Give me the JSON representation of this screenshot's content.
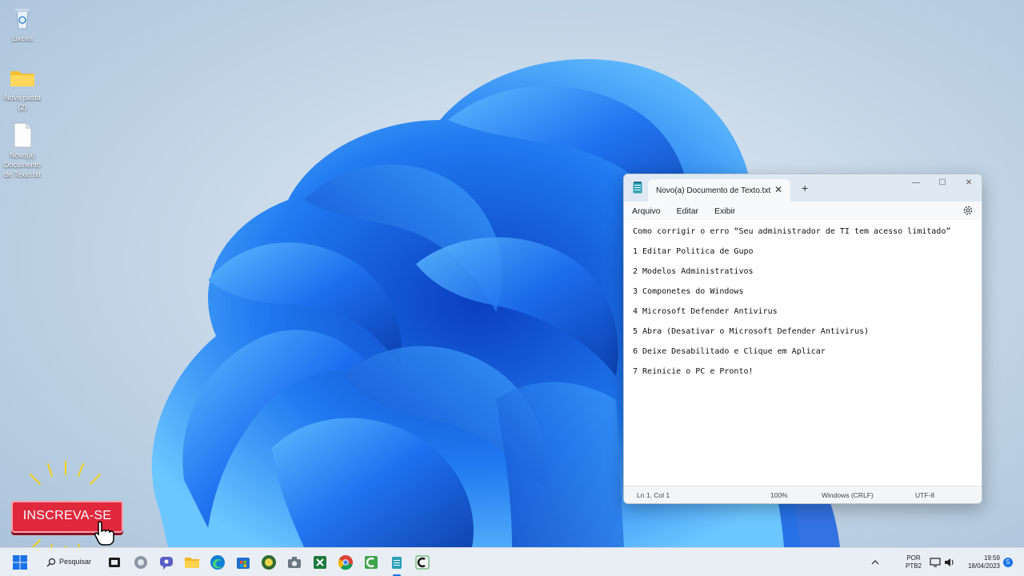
{
  "desktop": {
    "icons": [
      {
        "label": "Lixeira",
        "icon": "recycle-bin-icon"
      },
      {
        "label": "Nova pasta\n(2)",
        "icon": "folder-icon"
      },
      {
        "label": "Novo(a)\nDocumento\nde Texto.txt",
        "icon": "text-file-icon"
      }
    ]
  },
  "notepad": {
    "tab_title": "Novo(a) Documento de Texto.txt",
    "tab_close": "✕",
    "new_tab": "+",
    "window_min": "—",
    "window_max": "☐",
    "window_close": "✕",
    "menu": [
      "Arquivo",
      "Editar",
      "Exibir"
    ],
    "lines": [
      "Como corrigir o erro “Seu administrador de TI tem acesso limitado”",
      "1 Editar Politica de Gupo",
      "2 Modelos Administrativos",
      "3 Componetes do Windows",
      "4 Microsoft Defender Antivirus",
      "5 Abra (Desativar o Microsoft Defender Antivirus)",
      "6 Deixe Desabilitado e Clique em Aplicar",
      "7 Reinicie o PC e Pronto!"
    ],
    "status": {
      "position": "Ln 1, Col 1",
      "zoom": "100%",
      "line_ending": "Windows (CRLF)",
      "encoding": "UTF-8"
    }
  },
  "overlay": {
    "subscribe_label": "INSCREVA-SE"
  },
  "taskbar": {
    "search_label": "Pesquisar",
    "tray": {
      "language_top": "POR",
      "language_bottom": "PTB2",
      "time": "19:59",
      "date": "18/04/2023",
      "notification_count": "5"
    }
  },
  "colors": {
    "accent": "#1a73e8",
    "bloom_dark": "#0a4fd6",
    "bloom_light": "#4ab0ff",
    "subscribe_red": "#e0283c"
  }
}
